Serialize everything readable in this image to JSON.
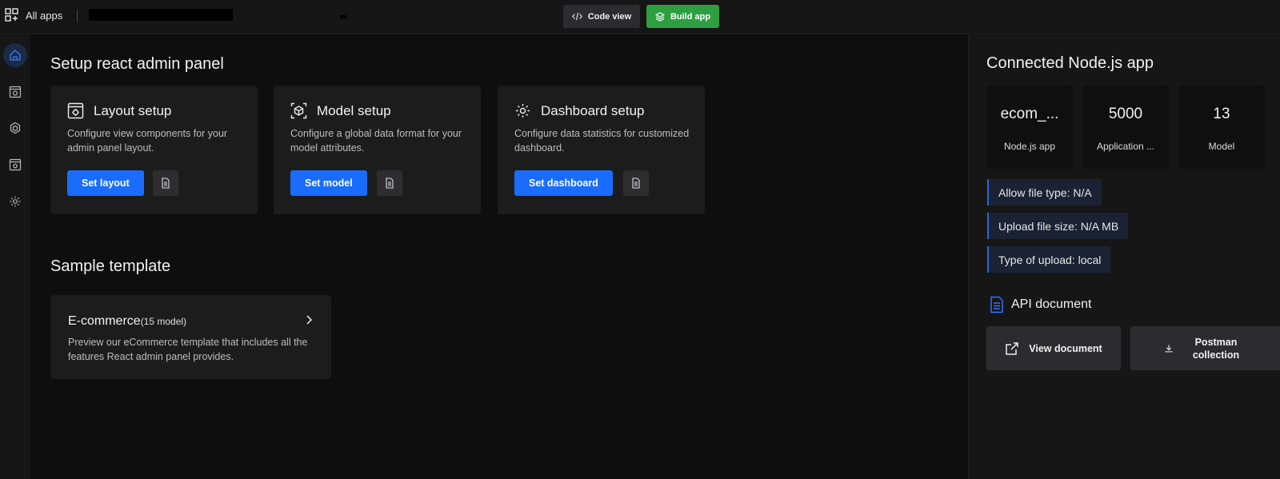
{
  "topbar": {
    "all_apps": "All apps",
    "code_view": "Code view",
    "build_app": "Build app"
  },
  "rail": {
    "items": [
      {
        "icon": "home-icon",
        "active": true
      },
      {
        "icon": "layout-settings-icon",
        "active": false
      },
      {
        "icon": "model-hex-icon",
        "active": false
      },
      {
        "icon": "dashboard-settings-icon",
        "active": false
      },
      {
        "icon": "gear-icon",
        "active": false
      }
    ]
  },
  "setup": {
    "title": "Setup react admin panel",
    "cards": [
      {
        "title": "Layout setup",
        "desc": "Configure view components for your admin panel layout.",
        "button": "Set layout",
        "icon": "layout-icon"
      },
      {
        "title": "Model setup",
        "desc": "Configure a global data format for your model attributes.",
        "button": "Set model",
        "icon": "model-icon"
      },
      {
        "title": "Dashboard setup",
        "desc": "Configure data statistics for customized dashboard.",
        "button": "Set dashboard",
        "icon": "gear-icon"
      }
    ]
  },
  "template": {
    "title": "Sample template",
    "card": {
      "name": "E-commerce",
      "count": "(15 model)",
      "desc": "Preview our eCommerce template that includes all the features React admin panel provides."
    }
  },
  "connected": {
    "title": "Connected Node.js app",
    "stats": [
      {
        "value": "ecom_...",
        "label": "Node.js app"
      },
      {
        "value": "5000",
        "label": "Application ..."
      },
      {
        "value": "13",
        "label": "Model"
      }
    ],
    "info": [
      "Allow file type:  N/A",
      "Upload file size:  N/A MB",
      "Type of upload:  local"
    ],
    "api_title": "API document",
    "view_document": "View document",
    "postman": "Postman collection"
  },
  "colors": {
    "accent": "#1a6cff",
    "build": "#2e9e42",
    "background": "#0e0e0f",
    "card": "#1c1c1d"
  }
}
